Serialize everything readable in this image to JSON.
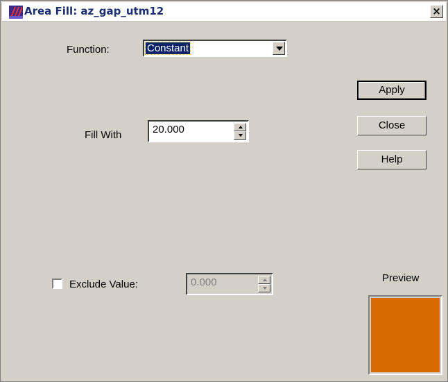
{
  "window": {
    "title": "Area Fill: az_gap_utm12",
    "close_glyph": "×"
  },
  "function": {
    "label": "Function:",
    "selected": "Constant"
  },
  "fill_with": {
    "label": "Fill With",
    "value": "20.000"
  },
  "exclude": {
    "label": "Exclude Value:",
    "checked": false,
    "value": "0.000"
  },
  "buttons": {
    "apply": "Apply",
    "close": "Close",
    "help": "Help"
  },
  "preview": {
    "label": "Preview",
    "color": "#d86a00"
  },
  "icons": [
    "app-logo-icon",
    "close-icon",
    "chevron-down-icon",
    "spin-up-icon",
    "spin-down-icon"
  ]
}
